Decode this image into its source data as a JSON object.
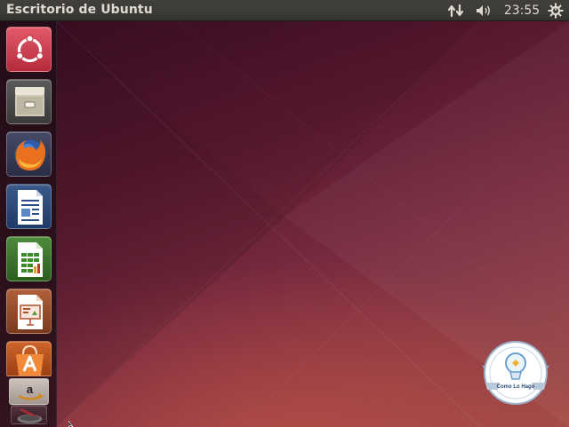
{
  "top_panel": {
    "title": "Escritorio de Ubuntu",
    "clock": "23:55",
    "network_icon": "network-up-down-icon",
    "sound_icon": "speaker-volume-icon",
    "session_icon": "gear-power-icon"
  },
  "launcher": {
    "items": [
      {
        "name": "dash",
        "icon": "ubuntu-logo-icon"
      },
      {
        "name": "files",
        "icon": "file-cabinet-icon"
      },
      {
        "name": "firefox",
        "icon": "firefox-icon"
      },
      {
        "name": "libreoffice-writer",
        "icon": "writer-document-icon"
      },
      {
        "name": "libreoffice-calc",
        "icon": "calc-spreadsheet-icon"
      },
      {
        "name": "libreoffice-impress",
        "icon": "impress-presentation-icon"
      },
      {
        "name": "ubuntu-software-center",
        "icon": "software-bag-icon"
      },
      {
        "name": "amazon",
        "icon": "amazon-icon"
      },
      {
        "name": "trash",
        "icon": "trash-icon"
      }
    ]
  },
  "badge": {
    "label": "Como Lo Hago",
    "icon": "lightbulb-icon"
  },
  "colors": {
    "panel_bg": "#3c3b37",
    "panel_text": "#dfdbd2",
    "wallpaper_dark": "#3a0c24",
    "wallpaper_light": "#a14b46",
    "launcher_bg": "#1e0e16"
  }
}
